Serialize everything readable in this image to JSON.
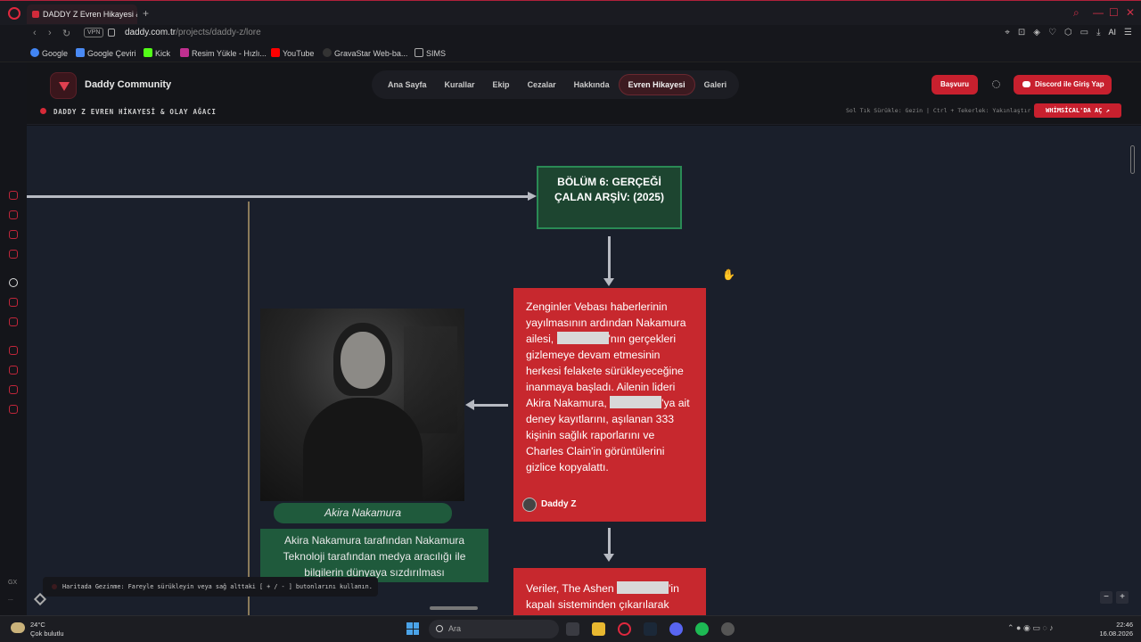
{
  "browser": {
    "tab_title": "DADDY Z Evren Hikayesi &",
    "new_tab": "+",
    "url_host": "daddy.com.tr",
    "url_path": "/projects/daddy-z/lore",
    "vpn_label": "VPN",
    "ai_label": "AI",
    "bookmarks": [
      {
        "label": "Google",
        "color": "#4285f4"
      },
      {
        "label": "Google Çeviri",
        "color": "#4a8af4"
      },
      {
        "label": "Kick",
        "color": "#53fc18"
      },
      {
        "label": "Resim Yükle - Hızlı...",
        "color": "#c03090"
      },
      {
        "label": "YouTube",
        "color": "#ff0000"
      },
      {
        "label": "GravaStar Web-ba...",
        "color": "#333333"
      },
      {
        "label": "SIMS",
        "color": "#888888"
      }
    ]
  },
  "sidebar_text": {
    "gx": "GX",
    "more": "..."
  },
  "header": {
    "brand": "Daddy Community",
    "nav": [
      "Ana Sayfa",
      "Kurallar",
      "Ekip",
      "Cezalar",
      "Hakkında",
      "Evren Hikayesi",
      "Galeri"
    ],
    "active_nav": "Evren Hikayesi",
    "apply_button": "Başvuru",
    "discord_button": "Discord ile Giriş Yap"
  },
  "subheader": {
    "title": "DADDY Z EVREN HİKAYESİ & OLAY AĞACI",
    "hint": "Sol Tık Sürükle: Gezin | Ctrl + Tekerlek: Yakınlaştır",
    "whimsical_button": "WHİMSİCAL'DA AÇ ↗"
  },
  "canvas": {
    "chapter_title": "BÖLÜM 6: GERÇEĞİ ÇALAN ARŞİV: (2025)",
    "story_parts": [
      "Zenginler Vebası haberlerinin yayılmasının ardından Nakamura ailesi, ",
      "'nın gerçekleri gizlemeye devam etmesinin herkesi felakete sürükleyeceğine inanmaya başladı. Ailenin lideri Akira Nakamura, ",
      "'ya ait deney kayıtlarını, aşılanan 333 kişinin sağlık raporlarını ve Charles Clain'in görüntülerini gizlice kopyalattı."
    ],
    "author": "Daddy Z",
    "portrait_name": "Akira Nakamura",
    "caption": "Akira Nakamura tarafından Nakamura Teknoloji tarafından medya aracılığı ile bilgilerin dünyaya sızdırılması",
    "story2_parts": [
      "Veriler, The Ashen ",
      "'in kapalı sisteminden çıkarılarak"
    ],
    "hint_toast": "Haritada Gezinme: Fareyle sürükleyin veya sağ alttaki [ + / - ] butonlarını kullanın.",
    "zoom_minus": "−",
    "zoom_plus": "+"
  },
  "taskbar": {
    "temp": "24°C",
    "weather": "Çok bulutlu",
    "search": "Ara",
    "time": "22:46",
    "date": "16.08.2026"
  },
  "icons": [
    "opera-icon",
    "back-icon",
    "forward-icon",
    "reload-icon",
    "lock-icon",
    "hand-cursor-icon",
    "sun-icon",
    "discord-icon",
    "search-icon",
    "windows-start-icon"
  ]
}
